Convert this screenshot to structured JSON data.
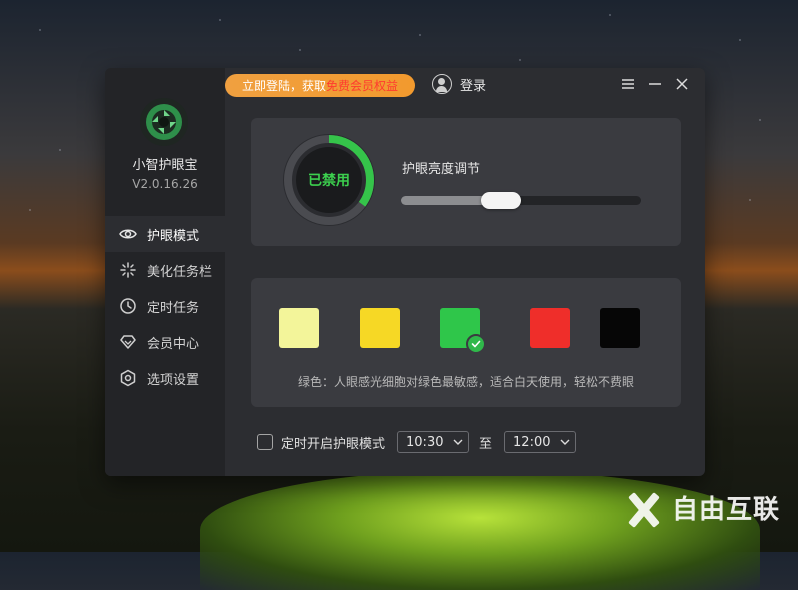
{
  "app": {
    "name": "小智护眼宝",
    "version": "V2.0.16.26"
  },
  "topbar": {
    "promo_prefix": "立即登陆，获取",
    "promo_highlight": "免费会员权益",
    "login_label": "登录"
  },
  "sidebar": {
    "items": [
      {
        "label": "护眼模式",
        "icon": "eye-icon",
        "active": true
      },
      {
        "label": "美化任务栏",
        "icon": "sparkle-icon",
        "active": false
      },
      {
        "label": "定时任务",
        "icon": "clock-icon",
        "active": false
      },
      {
        "label": "会员中心",
        "icon": "diamond-icon",
        "active": false
      },
      {
        "label": "选项设置",
        "icon": "hexagon-settings-icon",
        "active": false
      }
    ]
  },
  "mode_panel": {
    "status_text": "已禁用",
    "ring_progress": 0.35,
    "brightness_title": "护眼亮度调节",
    "brightness_value": 0.4
  },
  "color_panel": {
    "swatches": [
      {
        "name": "light-yellow",
        "color": "#f3f59a",
        "selected": false
      },
      {
        "name": "yellow",
        "color": "#f6d825",
        "selected": false
      },
      {
        "name": "green",
        "color": "#2fc64a",
        "selected": true
      },
      {
        "name": "red",
        "color": "#ef2e2a",
        "selected": false
      },
      {
        "name": "black",
        "color": "#060606",
        "selected": false
      }
    ],
    "description": "绿色：人眼感光细胞对绿色最敏感，适合白天使用，轻松不费眼"
  },
  "schedule": {
    "label": "定时开启护眼模式",
    "start_time": "10:30",
    "separator": "至",
    "end_time": "12:00",
    "enabled": false
  },
  "watermark": {
    "text": "自由互联"
  },
  "colors": {
    "accent_green": "#3ccf4e",
    "promo_orange": "#f29a2e",
    "promo_highlight": "#ff3b2f"
  }
}
